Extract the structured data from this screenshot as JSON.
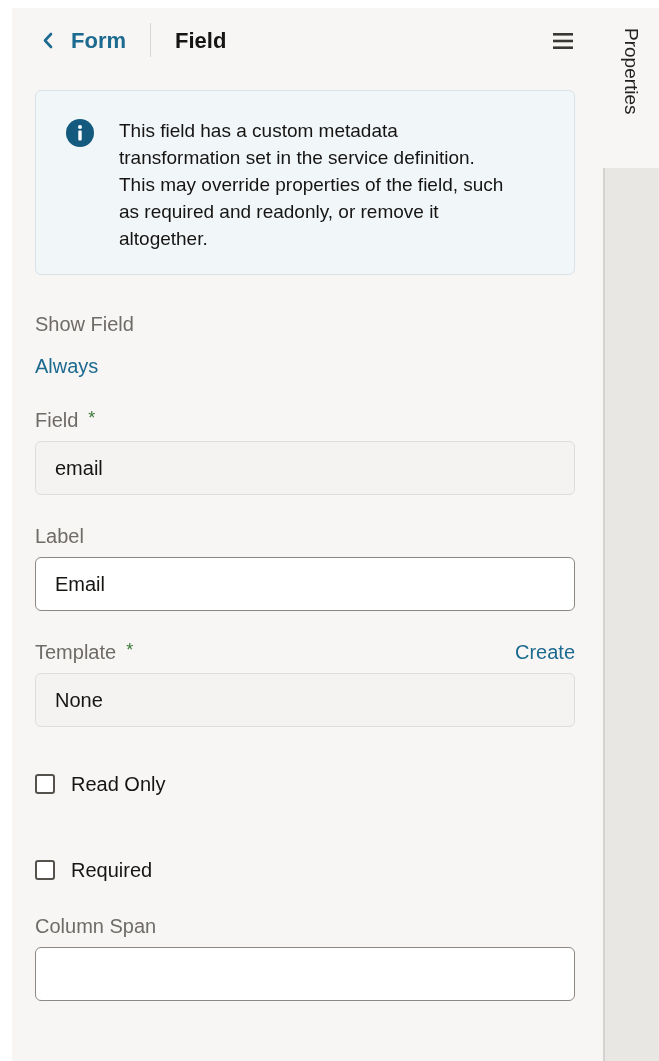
{
  "header": {
    "back_label": "Form",
    "title": "Field"
  },
  "notice": {
    "text": "This field has a custom metadata transformation set in the service definition. This may override properties of the field, such as required and readonly, or remove it altogether."
  },
  "show_field": {
    "label": "Show Field",
    "value": "Always"
  },
  "fields": [
    {
      "kind": "text",
      "label": "Field",
      "required_mark": "*",
      "value": "email",
      "readonly": true
    },
    {
      "kind": "text",
      "label": "Label",
      "value": "Email",
      "readonly": false
    },
    {
      "kind": "text",
      "label": "Template",
      "required_mark": "*",
      "action": "Create",
      "value": "None",
      "readonly": true
    },
    {
      "kind": "checkbox",
      "label": "Read Only",
      "checked": false
    },
    {
      "kind": "checkbox",
      "label": "Required",
      "checked": false
    },
    {
      "kind": "text",
      "label": "Column Span",
      "readonly": false
    }
  ],
  "side_tab": {
    "label": "Properties"
  }
}
